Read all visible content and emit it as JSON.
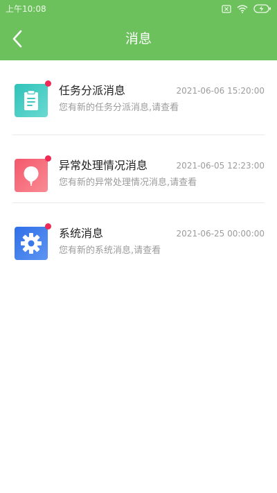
{
  "status_bar": {
    "time": "上午10:08"
  },
  "header": {
    "title": "消息",
    "background_color": "#6cc15d"
  },
  "messages": [
    {
      "title": "任务分派消息",
      "time": "2021-06-06 15:20:00",
      "description": "您有新的任务分派消息,请查看",
      "icon": "clipboard-icon",
      "icon_color": "#3cc8c0",
      "unread": true
    },
    {
      "title": "异常处理情况消息",
      "time": "2021-06-05 12:23:00",
      "description": "您有新的异常处理情况消息,请查看",
      "icon": "balloon-icon",
      "icon_color": "#f56c78",
      "unread": true
    },
    {
      "title": "系统消息",
      "time": "2021-06-25 00:00:00",
      "description": "您有新的系统消息,请查看",
      "icon": "gear-icon",
      "icon_color": "#3a78ea",
      "unread": true
    }
  ],
  "colors": {
    "unread_dot": "#ef2a55",
    "title_text": "#222222",
    "secondary_text": "#9b9b9b"
  }
}
